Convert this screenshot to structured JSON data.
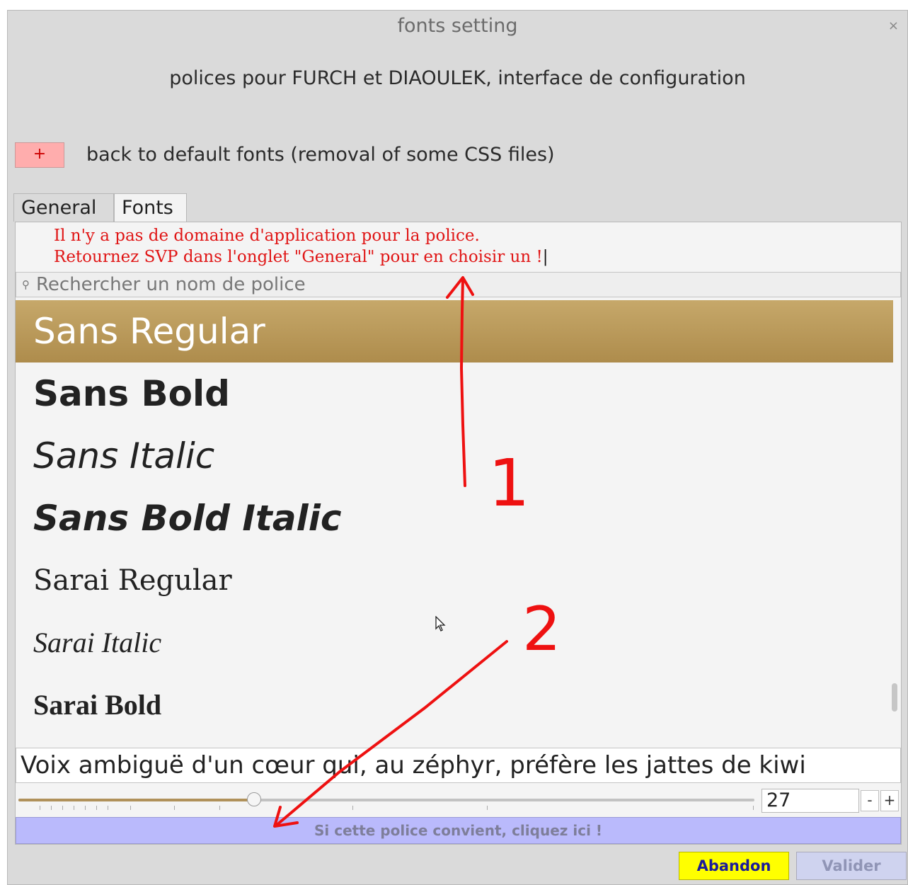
{
  "window": {
    "title": "fonts setting",
    "close_label": "×"
  },
  "header": {
    "subtitle": "polices pour FURCH et DIAOULEK, interface de configuration"
  },
  "reset": {
    "button_label": "+",
    "label": "back to default fonts (removal of some CSS files)"
  },
  "tabs": [
    {
      "label": "General"
    },
    {
      "label": "Fonts"
    }
  ],
  "message": {
    "line1": "Il n'y a pas de domaine d'application pour la police.",
    "line2": "Retournez SVP dans l'onglet \"General\" pour en choisir un !"
  },
  "search": {
    "placeholder": "Rechercher un nom de police"
  },
  "font_list": [
    {
      "name": "Sans Regular",
      "selected": true
    },
    {
      "name": "Sans Bold"
    },
    {
      "name": "Sans Italic"
    },
    {
      "name": "Sans Bold Italic"
    },
    {
      "name": "Sarai Regular"
    },
    {
      "name": "Sarai Italic"
    },
    {
      "name": "Sarai Bold"
    }
  ],
  "preview": {
    "text": "Voix ambiguë d'un cœur qui, au zéphyr, préfère les jattes de kiwi"
  },
  "size": {
    "value": "27",
    "minus_label": "-",
    "plus_label": "+",
    "slider_fraction": 0.32
  },
  "apply": {
    "label": "Si cette police convient, cliquez ici !"
  },
  "footer": {
    "cancel_label": "Abandon",
    "ok_label": "Valider"
  },
  "annotations": {
    "label1": "1",
    "label2": "2",
    "color": "#ee1111"
  },
  "colors": {
    "selected_row": "#b89a5c",
    "message_text": "#e01515",
    "apply_bar": "#babafc",
    "cancel_button": "#ffff00"
  }
}
